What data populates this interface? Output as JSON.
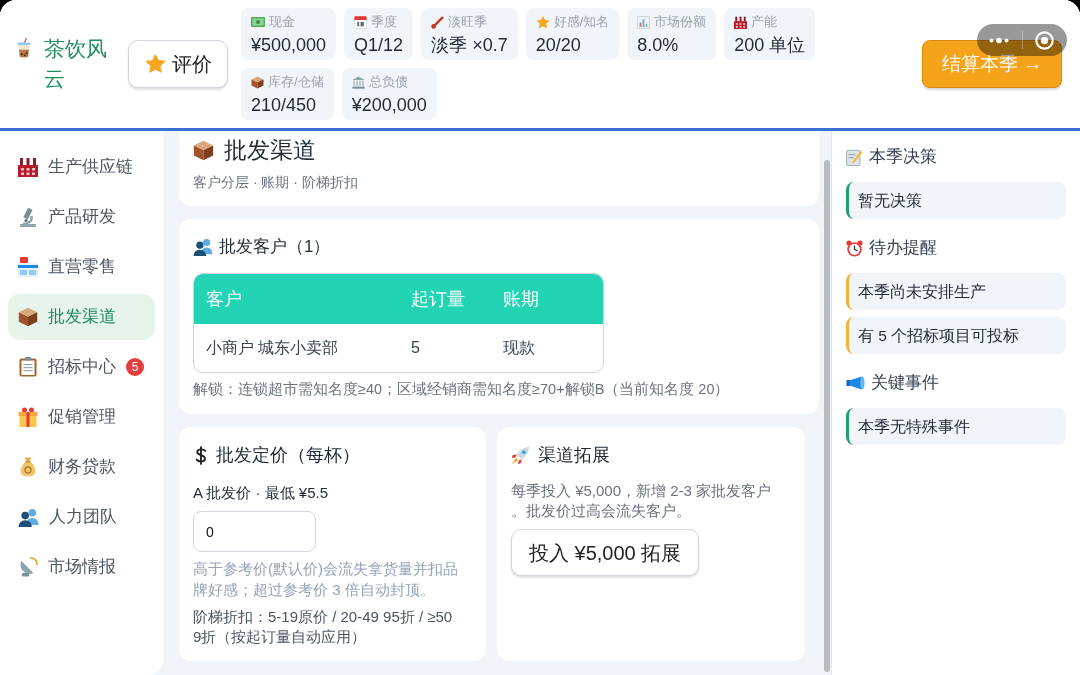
{
  "header": {
    "app_title": "茶饮风云",
    "rate_button": "评价",
    "stats": [
      {
        "label": "现金",
        "value": "¥500,000"
      },
      {
        "label": "季度",
        "value": "Q1/12"
      },
      {
        "label": "淡旺季",
        "value": "淡季 ×0.7"
      },
      {
        "label": "好感/知名",
        "value": "20/20"
      },
      {
        "label": "市场份额",
        "value": "8.0%"
      },
      {
        "label": "产能",
        "value": "200 单位"
      },
      {
        "label": "库存/仓储",
        "value": "210/450"
      },
      {
        "label": "总负债",
        "value": "¥200,000"
      }
    ],
    "settle_button": "结算本季 →"
  },
  "sidebar": {
    "items": [
      {
        "label": "生产供应链",
        "selected": false
      },
      {
        "label": "产品研发",
        "selected": false
      },
      {
        "label": "直营零售",
        "selected": false
      },
      {
        "label": "批发渠道",
        "selected": true
      },
      {
        "label": "招标中心",
        "selected": false,
        "badge": "5"
      },
      {
        "label": "促销管理",
        "selected": false
      },
      {
        "label": "财务贷款",
        "selected": false
      },
      {
        "label": "人力团队",
        "selected": false
      },
      {
        "label": "市场情报",
        "selected": false
      }
    ]
  },
  "page": {
    "title": "批发渠道",
    "subtitle": "客户分层 · 账期 · 阶梯折扣"
  },
  "customers": {
    "title": "批发客户（1）",
    "table": {
      "columns": [
        "客户",
        "起订量",
        "账期"
      ],
      "rows": [
        [
          "小商户 城东小卖部",
          "5",
          "现款"
        ]
      ]
    },
    "note": "解锁：连锁超市需知名度≥40；区域经销商需知名度≥70+解锁B（当前知名度 20）"
  },
  "pricing": {
    "title": "批发定价（每杯）",
    "field_label": "A 批发价 · 最低 ¥5.5",
    "input": {
      "value": "0"
    },
    "hint": "高于参考价(默认价)会流失拿货量并扣品牌好感；超过参考价 3 倍自动封顶。",
    "tiers": "阶梯折扣：5-19原价 / 20-49 95折 / ≥50 9折（按起订量自动应用）"
  },
  "expansion": {
    "title": "渠道拓展",
    "description": "每季投入 ¥5,000，新增 2-3 家批发客户。批发价过高会流失客户。",
    "button": "投入 ¥5,000 拓展"
  },
  "side_panel": {
    "sections": [
      {
        "title": "本季决策",
        "items": [
          {
            "text": "暂无决策",
            "color": "#22a06b"
          }
        ]
      },
      {
        "title": "待办提醒",
        "items": [
          {
            "text": "本季尚未安排生产",
            "color": "#f0b23a"
          },
          {
            "text": "有 5 个招标项目可投标",
            "color": "#f0b23a"
          }
        ]
      },
      {
        "title": "关键事件",
        "items": [
          {
            "text": "本季无特殊事件",
            "color": "#22a06b"
          }
        ]
      }
    ]
  }
}
